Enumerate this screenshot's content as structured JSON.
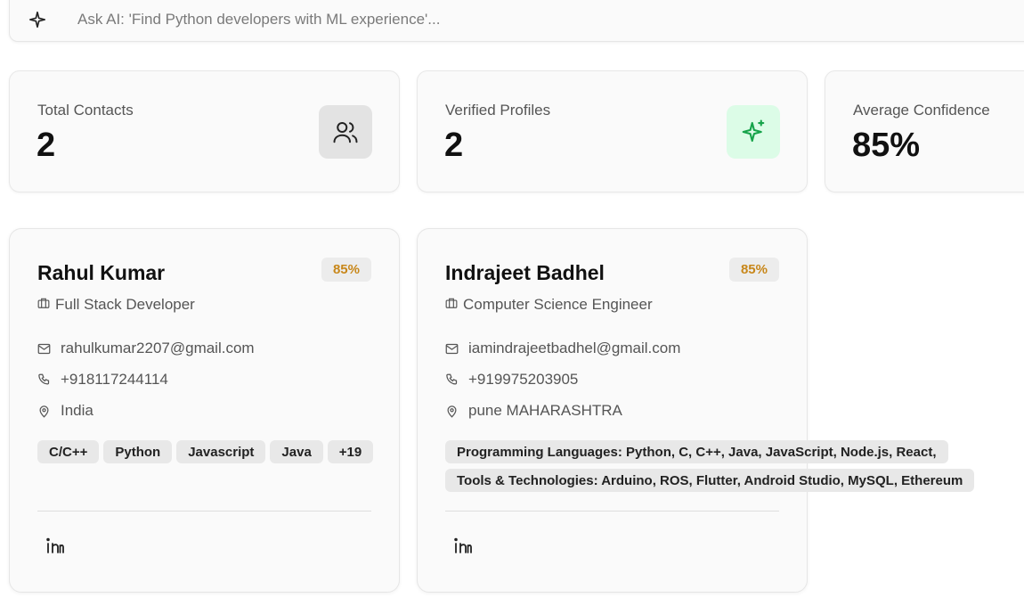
{
  "ask": {
    "placeholder": "Ask AI: 'Find Python developers with ML experience'...",
    "icon": "sparkles-icon"
  },
  "stats": [
    {
      "label": "Total Contacts",
      "value": "2",
      "icon": "users-icon",
      "badge_color": "#e3e3e3"
    },
    {
      "label": "Verified Profiles",
      "value": "2",
      "icon": "sparkles-icon",
      "badge_color": "#dcfce7",
      "icon_color": "#16a34a"
    },
    {
      "label": "Average Confidence",
      "value": "85%"
    }
  ],
  "contacts": [
    {
      "name": "Rahul Kumar",
      "confidence": "85%",
      "role": "Full Stack Developer",
      "email": "rahulkumar2207@gmail.com",
      "phone": "+918117244114",
      "location": "India",
      "tags": [
        "C/C++",
        "Python",
        "Javascript",
        "Java",
        "+19"
      ]
    },
    {
      "name": "Indrajeet Badhel",
      "confidence": "85%",
      "role": "Computer Science Engineer",
      "email": "iamindrajeetbadhel@gmail.com",
      "phone": "+919975203905",
      "location": "pune MAHARASHTRA",
      "tags": [
        "Programming Languages: Python, C, C++, Java, JavaScript, Node.js, React,",
        "Tools & Technologies: Arduino, ROS, Flutter, Android Studio, MySQL, Ethereum"
      ]
    }
  ],
  "colors": {
    "accent_conf": "#c8871a",
    "verified_green": "#16a34a"
  }
}
